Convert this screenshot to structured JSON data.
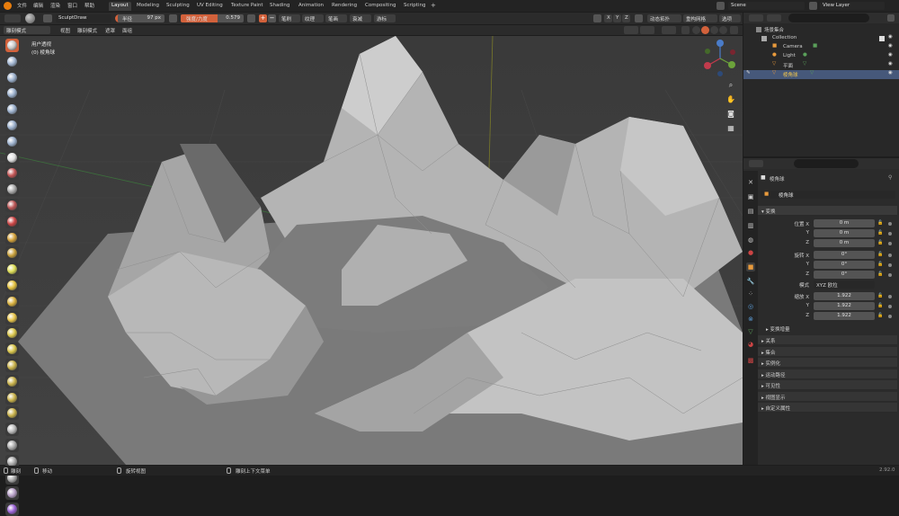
{
  "menu": [
    "文件",
    "编辑",
    "渲染",
    "窗口",
    "帮助"
  ],
  "workspaces": [
    "Layout",
    "Modeling",
    "Sculpting",
    "UV Editing",
    "Texture Paint",
    "Shading",
    "Animation",
    "Rendering",
    "Compositing",
    "Scripting"
  ],
  "active_workspace": "Layout",
  "scene": "Scene",
  "view_layer": "View Layer",
  "tool_header": {
    "brush": "SculptDraw",
    "radius_label": "半径",
    "radius_value": "97 px",
    "strength_label": "强度/力度",
    "strength_value": "0.579",
    "menus": [
      "笔刷",
      "纹理",
      "笔画",
      "衰减",
      "游标"
    ],
    "axes": [
      "X",
      "Y",
      "Z"
    ],
    "dyntopo": "动态拓扑",
    "remesh": "重构网格",
    "options": "选项"
  },
  "view_header": {
    "mode": "雕刻模式",
    "menus": [
      "视图",
      "雕刻模式",
      "遮罩",
      "面组"
    ]
  },
  "viewport": {
    "view_name": "用户透视",
    "object_label": "(0) 棱角球"
  },
  "outliner": {
    "root": "场景集合",
    "collection": "Collection",
    "items": [
      "Camera",
      "Light",
      "平面",
      "棱角球"
    ]
  },
  "properties": {
    "object_name": "棱角球",
    "data_name": "棱角球",
    "transform_section": "变换",
    "location": {
      "label": "位置 X",
      "y": "Y",
      "z": "Z",
      "values": [
        "0 m",
        "0 m",
        "0 m"
      ]
    },
    "rotation": {
      "label": "旋转 X",
      "y": "Y",
      "z": "Z",
      "values": [
        "0°",
        "0°",
        "0°"
      ]
    },
    "mode_label": "模式",
    "mode_value": "XYZ 欧拉",
    "scale": {
      "label": "缩放 X",
      "y": "Y",
      "z": "Z",
      "values": [
        "1.922",
        "1.922",
        "1.922"
      ]
    },
    "delta": "变换增量",
    "sections": [
      "关系",
      "集合",
      "实例化",
      "运动路径",
      "可见性",
      "视图显示",
      "自定义属性"
    ]
  },
  "status": {
    "left1": "雕刻",
    "left2": "移动",
    "mid1": "旋转视图",
    "mid2": "雕刻上下文菜单",
    "version": "2.92.0"
  },
  "colors": {
    "accent": "#d2613b",
    "active_tab": "#3d3d3d",
    "viewport_bg": "#3d3d3d",
    "mesh": "#a9a9a9"
  },
  "tool_icons": [
    "draw",
    "draw-sharp",
    "clay",
    "clay-strips",
    "clay-thumb",
    "layer",
    "inflate",
    "blob",
    "crease",
    "smooth",
    "flatten",
    "fill",
    "scrape",
    "multiplane-scrape",
    "pinch",
    "grab",
    "elastic-deform",
    "snake-hook",
    "thumb",
    "pose",
    "nudge",
    "rotate",
    "slide-relax",
    "boundary",
    "cloth",
    "simplify",
    "mask",
    "draw-face-sets",
    "box-trim",
    "annotate"
  ]
}
